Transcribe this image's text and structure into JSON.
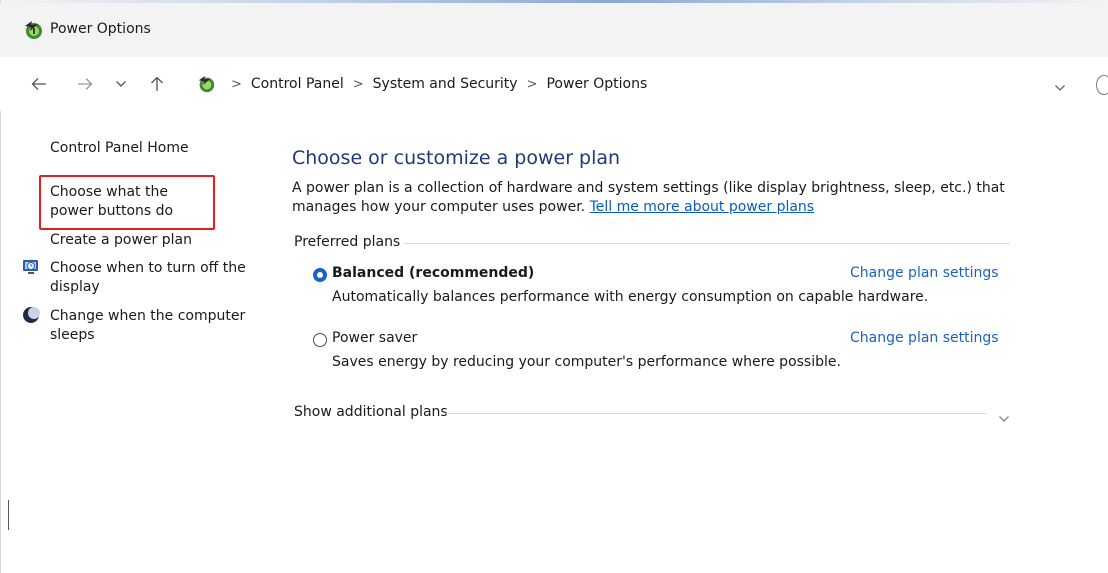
{
  "window": {
    "title": "Power Options"
  },
  "address": {
    "breadcrumbs": [
      "Control Panel",
      "System and Security",
      "Power Options"
    ]
  },
  "sidebar": {
    "home": "Control Panel Home",
    "power_buttons": "Choose what the power buttons do",
    "create_plan": "Create a power plan",
    "turn_off_display": "Choose when to turn off the display",
    "sleep": "Change when the computer sleeps"
  },
  "main": {
    "heading": "Choose or customize a power plan",
    "description": "A power plan is a collection of hardware and system settings (like display brightness, sleep, etc.) that manages how your computer uses power.",
    "learn_more": "Tell me more about power plans",
    "preferred_label": "Preferred plans",
    "plans": [
      {
        "name": "Balanced (recommended)",
        "selected": true,
        "description": "Automatically balances performance with energy consumption on capable hardware.",
        "settings_link": "Change plan settings"
      },
      {
        "name": "Power saver",
        "selected": false,
        "description": "Saves energy by reducing your computer's performance where possible.",
        "settings_link": "Change plan settings"
      }
    ],
    "additional_label": "Show additional plans"
  },
  "colors": {
    "accent": "#1a62c5",
    "heading": "#20397a",
    "highlight": "#e02020"
  },
  "icons": {
    "app": "power-options-icon",
    "back": "back-arrow-icon",
    "forward": "forward-arrow-icon",
    "recent": "chevron-down-icon",
    "up": "up-arrow-icon",
    "address_dropdown": "chevron-down-icon"
  }
}
